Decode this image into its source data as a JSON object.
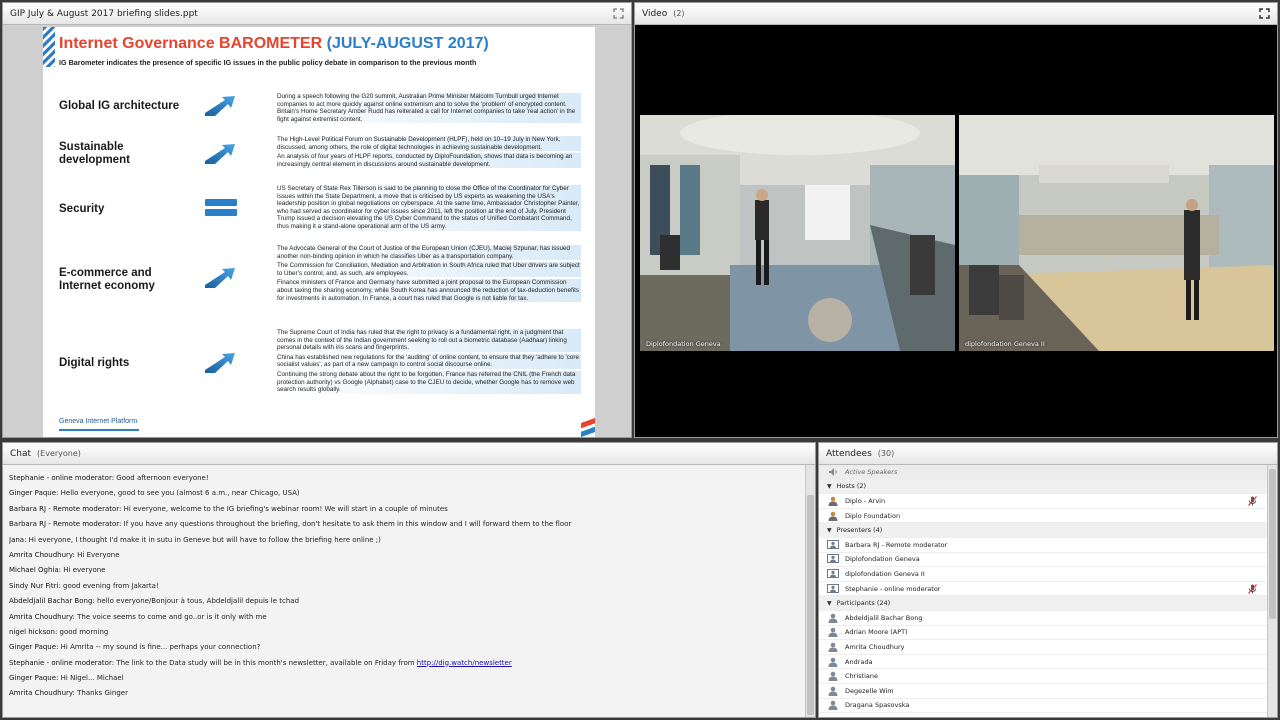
{
  "share_pod": {
    "title": "GIP July & August 2017 briefing slides.ppt",
    "slide": {
      "title_main": "Internet Governance BAROMETER",
      "title_period": "(JULY-AUGUST 2017)",
      "subtitle": "IG Barometer indicates the presence of specific IG issues in the public policy debate in comparison to the previous month",
      "footer": "Geneva Internet Platform",
      "topics": [
        {
          "label": "Global IG architecture",
          "trend": "up",
          "paragraphs": [
            "During a speech following the G20 summit, Australian Prime Minister Malcolm Turnbull urged Internet companies to act more quickly against online extremism and to solve the 'problem' of encrypted content. Britain's Home Secretary Amber Rudd has reiterated a call for Internet companies to take 'real action' in the fight against extremist content."
          ]
        },
        {
          "label": "Sustainable\ndevelopment",
          "trend": "up",
          "paragraphs": [
            "The High-Level Political Forum on Sustainable Development (HLPF), held on 10–19 July in New York, discussed, among others, the role of digital technologies in achieving sustainable development.",
            "An analysis of four years of HLPF reports, conducted by DiploFoundation, shows that data is becoming an increasingly central element in discussions around sustainable development."
          ]
        },
        {
          "label": "Security",
          "trend": "same",
          "paragraphs": [
            "US Secretary of State Rex Tillerson is said to be planning to close the Office of the Coordinator for Cyber Issues within the State Department, a move that is criticised by US experts as weakening the USA's leadership position in global negotiations on cyberspace. At the same time, Ambassador Christopher Painter, who had served as coordinator for cyber issues since 2011, left the position at the end of July. President Trump issued a decision elevating the US Cyber Command to the status of Unified Combatant Command, thus making it a stand-alone operational arm of the US army."
          ]
        },
        {
          "label": "E-commerce and\nInternet economy",
          "trend": "up",
          "paragraphs": [
            "The Advocate General of the Court of Justice of the European Union (CJEU), Maciej Szpunar, has issued another non-binding opinion in which he classifies Uber as a transportation company.",
            "The Commission for Conciliation, Mediation and Arbitration in South Africa ruled that Uber drivers are subject to Uber's control, and, as such, are employees.",
            "Finance ministers of France and Germany have submitted a joint proposal to the European Commission about taxing the sharing economy, while South Korea has announced the reduction of tax-deduction benefits for investments in automation. In France, a court has ruled that Google is not liable for tax."
          ]
        },
        {
          "label": "Digital rights",
          "trend": "up",
          "paragraphs": [
            "The Supreme Court of India has ruled that the right to privacy is a fundamental right, in a judgment that comes in the context of the Indian government seeking to roll out a biometric database (Aadhaar) linking personal details with iris scans and fingerprints.",
            "China has established new regulations for the 'auditing' of online content, to ensure that they 'adhere to 'core socialist values', as part of a new campaign to control social discourse online.",
            "Continuing the strong debate about the right to be forgotten, France has referred the CNIL (the French data protection authority) vs Google (Alphabet) case to the CJEU to decide, whether Google has to remove web search results globally."
          ]
        }
      ]
    }
  },
  "video_pod": {
    "title": "Video",
    "count": "(2)",
    "cameras": [
      {
        "label": "Diplofondation Geneva"
      },
      {
        "label": "diplofondation Geneva II"
      }
    ]
  },
  "chat_pod": {
    "title": "Chat",
    "scope": "(Everyone)",
    "messages": [
      {
        "sender": "Stephanie - online moderator:",
        "text": " Good afternoon everyone!"
      },
      {
        "sender": "Ginger Paque:",
        "text": " Hello everyone, good to see you (almost 6 a.m., near Chicago, USA)"
      },
      {
        "sender": "Barbara RJ - Remote moderator:",
        "text": " Hi everyone, welcome to the IG briefing's webinar room! We will start in a couple of minutes"
      },
      {
        "sender": "Barbara RJ - Remote moderator:",
        "text": " If you have any questions throughout the briefing, don't hesitate to ask them in this window and I will forward them to the floor"
      },
      {
        "sender": "Jana:",
        "text": " Hi everyone, I thought I'd make it in sutu in Geneve but will have to follow the briefing here online ;)"
      },
      {
        "sender": "Amrita Choudhury:",
        "text": " Hi Everyone"
      },
      {
        "sender": "Michael Oghia:",
        "text": " Hi everyone"
      },
      {
        "sender": "Sindy Nur Fitri:",
        "text": " good evening from Jakarta!"
      },
      {
        "sender": "Abdeldjalil Bachar Bong:",
        "text": " hello everyone/Bonjour à tous, Abdeldjalil depuis le tchad"
      },
      {
        "sender": "Amrita Choudhury:",
        "text": " The voice seems to come and go..or is it only with me"
      },
      {
        "sender": "nigel hickson:",
        "text": " good morning"
      },
      {
        "sender": "Ginger Paque:",
        "text": " Hi Amrita -- my sound is fine... perhaps your connection?"
      },
      {
        "sender": "Stephanie - online moderator:",
        "text": " The link to the Data study will be in this month's newsletter, available on Friday from ",
        "link": "http://dig.watch/newsletter"
      },
      {
        "sender": "Ginger Paque:",
        "text": " Hi Nigel... Michael"
      },
      {
        "sender": "Amrita Choudhury:",
        "text": " Thanks Ginger"
      }
    ]
  },
  "attendees_pod": {
    "title": "Attendees",
    "count": "(30)",
    "active_speakers_label": "Active Speakers",
    "hosts": {
      "label": "Hosts (2)",
      "people": [
        {
          "name": "Diplo - Arvin",
          "mic": true
        },
        {
          "name": "Diplo Foundation",
          "mic": false
        }
      ]
    },
    "presenters": {
      "label": "Presenters (4)",
      "people": [
        {
          "name": "Barbara RJ - Remote moderator",
          "mic": false
        },
        {
          "name": "Diplofondation Geneva",
          "mic": false
        },
        {
          "name": "diplofondation Geneva II",
          "mic": false
        },
        {
          "name": "Stephanie - online moderator",
          "mic": true
        }
      ]
    },
    "participants": {
      "label": "Participants (24)",
      "people": [
        {
          "name": "Abdeldjalil Bachar Bong",
          "mic": false
        },
        {
          "name": "Adrian Moore (APT)",
          "mic": false
        },
        {
          "name": "Amrita Choudhury",
          "mic": false
        },
        {
          "name": "Andrada",
          "mic": false
        },
        {
          "name": "Christiane",
          "mic": false
        },
        {
          "name": "Degezelle  Wim",
          "mic": false
        },
        {
          "name": "Dragana Spasovska",
          "mic": false
        }
      ]
    }
  }
}
